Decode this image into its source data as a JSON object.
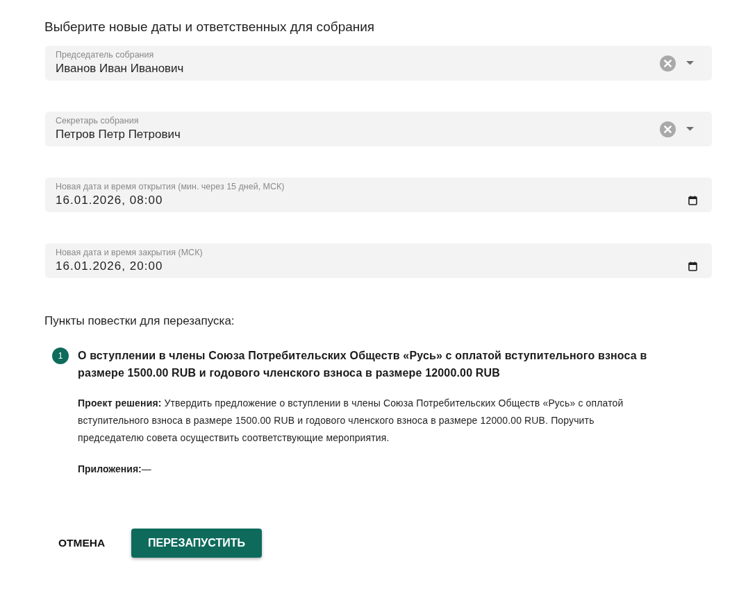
{
  "heading": "Выберите новые даты и ответственных для собрания",
  "fields": [
    {
      "kind": "select",
      "label": "Председатель собрания",
      "value": "Иванов Иван Иванович"
    },
    {
      "kind": "select",
      "label": "Секретарь собрания",
      "value": "Петров Петр Петрович"
    },
    {
      "kind": "datetime",
      "label": "Новая дата и время открытия (мин. через 15 дней, МСК)",
      "value": "16.01.2026, 08:00"
    },
    {
      "kind": "datetime",
      "label": "Новая дата и время закрытия (МСК)",
      "value": "16.01.2026, 20:00"
    }
  ],
  "agenda": {
    "heading": "Пункты повестки для перезапуска:",
    "items": [
      {
        "number": "1",
        "title": "О вступлении в члены Союза Потребительских Обществ «Русь» с оплатой вступительного взноса в размере 1500.00 RUB и годового членского взноса в размере 12000.00 RUB",
        "decision": "**Проект решения:** Утвердить предложение о вступлении в члены Союза Потребительских Обществ «Русь» с оплатой вступительного взноса в размере 1500.00 RUB и годового членского взноса в размере 12000.00 RUB. Поручить председателю совета осуществить соответствующие мероприятия.",
        "attachments": "**Приложения:**—"
      }
    ]
  },
  "buttons": [
    {
      "kind": "text",
      "label": "ОТМЕНА"
    },
    {
      "kind": "contained",
      "label": "ПЕРЕЗАПУСТИТЬ"
    }
  ]
}
